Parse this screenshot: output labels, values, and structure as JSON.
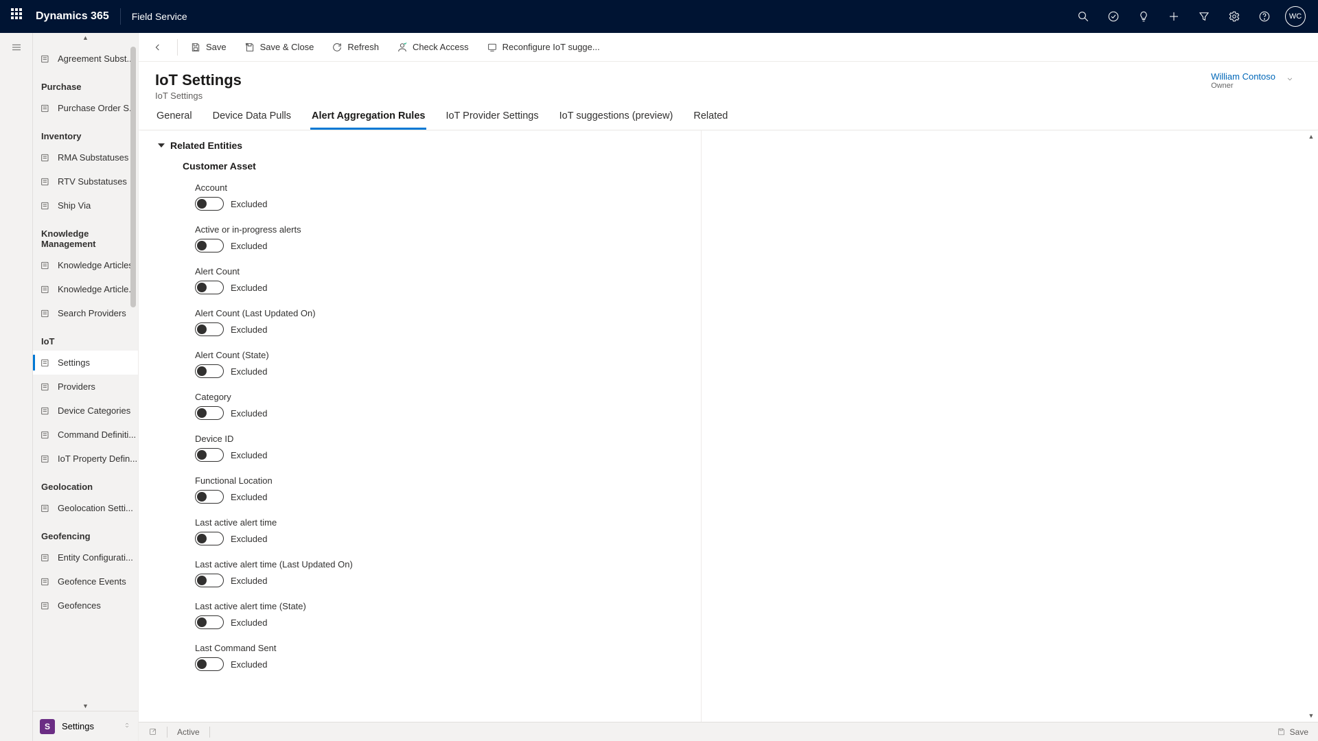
{
  "topnav": {
    "brand": "Dynamics 365",
    "app": "Field Service",
    "avatar": "WC"
  },
  "commands": {
    "save": "Save",
    "save_close": "Save & Close",
    "refresh": "Refresh",
    "check_access": "Check Access",
    "reconfigure": "Reconfigure IoT sugge..."
  },
  "header": {
    "title": "IoT Settings",
    "subtitle": "IoT Settings",
    "owner_name": "William Contoso",
    "owner_role": "Owner"
  },
  "tabs": [
    {
      "label": "General",
      "active": false
    },
    {
      "label": "Device Data Pulls",
      "active": false
    },
    {
      "label": "Alert Aggregation Rules",
      "active": true
    },
    {
      "label": "IoT Provider Settings",
      "active": false
    },
    {
      "label": "IoT suggestions (preview)",
      "active": false
    },
    {
      "label": "Related",
      "active": false
    }
  ],
  "sidebar": {
    "top_item": "Agreement Subst...",
    "groups": [
      {
        "name": "Purchase",
        "items": [
          {
            "label": "Purchase Order S..."
          }
        ]
      },
      {
        "name": "Inventory",
        "items": [
          {
            "label": "RMA Substatuses"
          },
          {
            "label": "RTV Substatuses"
          },
          {
            "label": "Ship Via"
          }
        ]
      },
      {
        "name": "Knowledge Management",
        "items": [
          {
            "label": "Knowledge Articles"
          },
          {
            "label": "Knowledge Article..."
          },
          {
            "label": "Search Providers"
          }
        ]
      },
      {
        "name": "IoT",
        "items": [
          {
            "label": "Settings",
            "active": true
          },
          {
            "label": "Providers"
          },
          {
            "label": "Device Categories"
          },
          {
            "label": "Command Definiti..."
          },
          {
            "label": "IoT Property Defin..."
          }
        ]
      },
      {
        "name": "Geolocation",
        "items": [
          {
            "label": "Geolocation Setti..."
          }
        ]
      },
      {
        "name": "Geofencing",
        "items": [
          {
            "label": "Entity Configurati..."
          },
          {
            "label": "Geofence Events"
          },
          {
            "label": "Geofences"
          }
        ]
      }
    ],
    "area_label": "Settings",
    "area_badge": "S"
  },
  "form": {
    "group": "Related Entities",
    "subgroup": "Customer Asset",
    "toggle_state": "Excluded",
    "fields": [
      "Account",
      "Active or in-progress alerts",
      "Alert Count",
      "Alert Count (Last Updated On)",
      "Alert Count (State)",
      "Category",
      "Device ID",
      "Functional Location",
      "Last active alert time",
      "Last active alert time (Last Updated On)",
      "Last active alert time (State)",
      "Last Command Sent"
    ]
  },
  "statusbar": {
    "status": "Active",
    "save": "Save"
  }
}
